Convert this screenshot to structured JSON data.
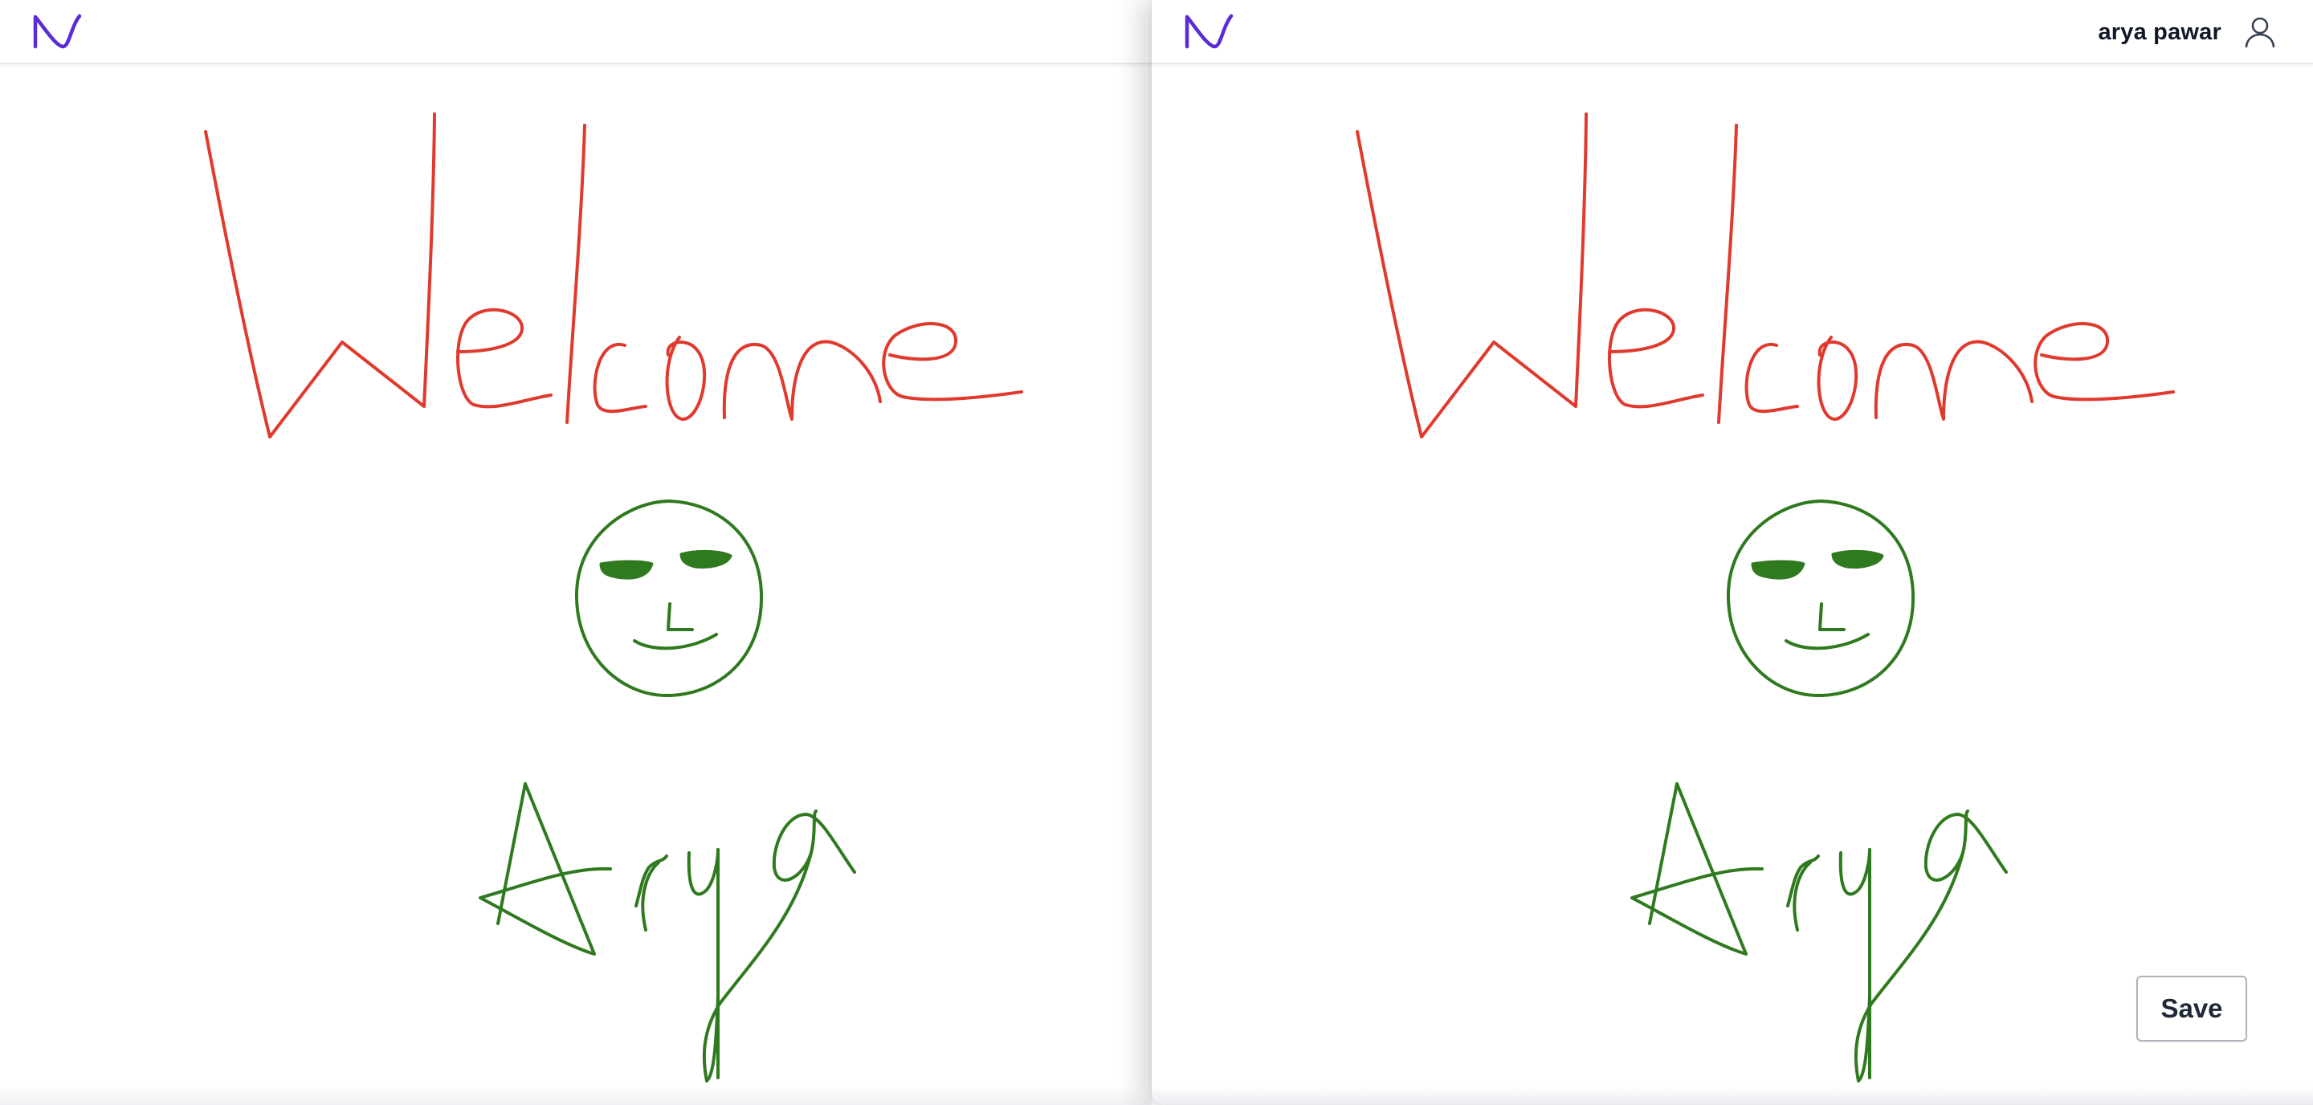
{
  "user": {
    "name": "arya pawar"
  },
  "actions": {
    "save_label": "Save"
  },
  "colors": {
    "brand_logo": "#5b2bd6",
    "stroke_red": "#e03a2e",
    "stroke_green": "#2f7a1e"
  },
  "icons": {
    "logo": "n-logo-icon",
    "user": "user-icon"
  }
}
